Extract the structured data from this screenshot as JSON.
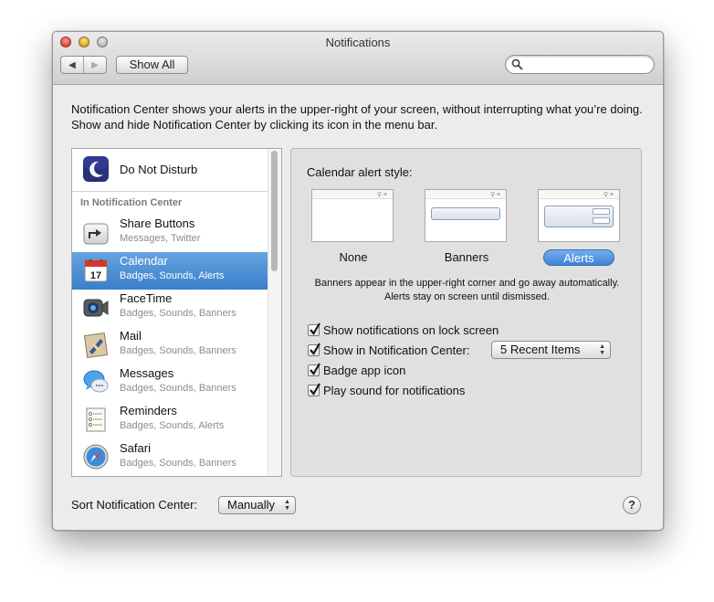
{
  "window": {
    "title": "Notifications"
  },
  "toolbar": {
    "back_label": "◀",
    "forward_label": "▶",
    "show_all_label": "Show All",
    "search_placeholder": ""
  },
  "intro_text": "Notification Center shows your alerts in the upper-right of your screen, without interrupting what you’re doing. Show and hide Notification Center by clicking its icon in the menu bar.",
  "sidebar": {
    "do_not_disturb": "Do Not Disturb",
    "section_header": "In Notification Center",
    "items": [
      {
        "name": "Share Buttons",
        "sub": "Messages, Twitter",
        "icon": "share-icon"
      },
      {
        "name": "Calendar",
        "sub": "Badges, Sounds, Alerts",
        "icon": "calendar-icon",
        "selected": true,
        "calendar_day": "17"
      },
      {
        "name": "FaceTime",
        "sub": "Badges, Sounds, Banners",
        "icon": "facetime-icon"
      },
      {
        "name": "Mail",
        "sub": "Badges, Sounds, Banners",
        "icon": "mail-icon"
      },
      {
        "name": "Messages",
        "sub": "Badges, Sounds, Banners",
        "icon": "messages-icon"
      },
      {
        "name": "Reminders",
        "sub": "Badges, Sounds, Alerts",
        "icon": "reminders-icon"
      },
      {
        "name": "Safari",
        "sub": "Badges, Sounds, Banners",
        "icon": "safari-icon"
      }
    ]
  },
  "detail": {
    "alert_style_label": "Calendar alert style:",
    "styles": [
      {
        "label": "None",
        "selected": false
      },
      {
        "label": "Banners",
        "selected": false
      },
      {
        "label": "Alerts",
        "selected": true
      }
    ],
    "help_text": "Banners appear in the upper-right corner and go away automatically. Alerts stay on screen until dismissed.",
    "checkboxes": [
      {
        "label": "Show notifications on lock screen",
        "checked": true
      },
      {
        "label": "Show in Notification Center:",
        "checked": true
      },
      {
        "label": "Badge app icon",
        "checked": true
      },
      {
        "label": "Play sound for notifications",
        "checked": true
      }
    ],
    "recent_items_value": "5 Recent Items"
  },
  "footer": {
    "sort_label": "Sort Notification Center:",
    "sort_value": "Manually",
    "help_label": "?"
  },
  "colors": {
    "selection": "#3a7fcc",
    "alerts_pill": "#3d84d6",
    "panel_bg": "#e0e0e0",
    "window_bg": "#ececec"
  }
}
